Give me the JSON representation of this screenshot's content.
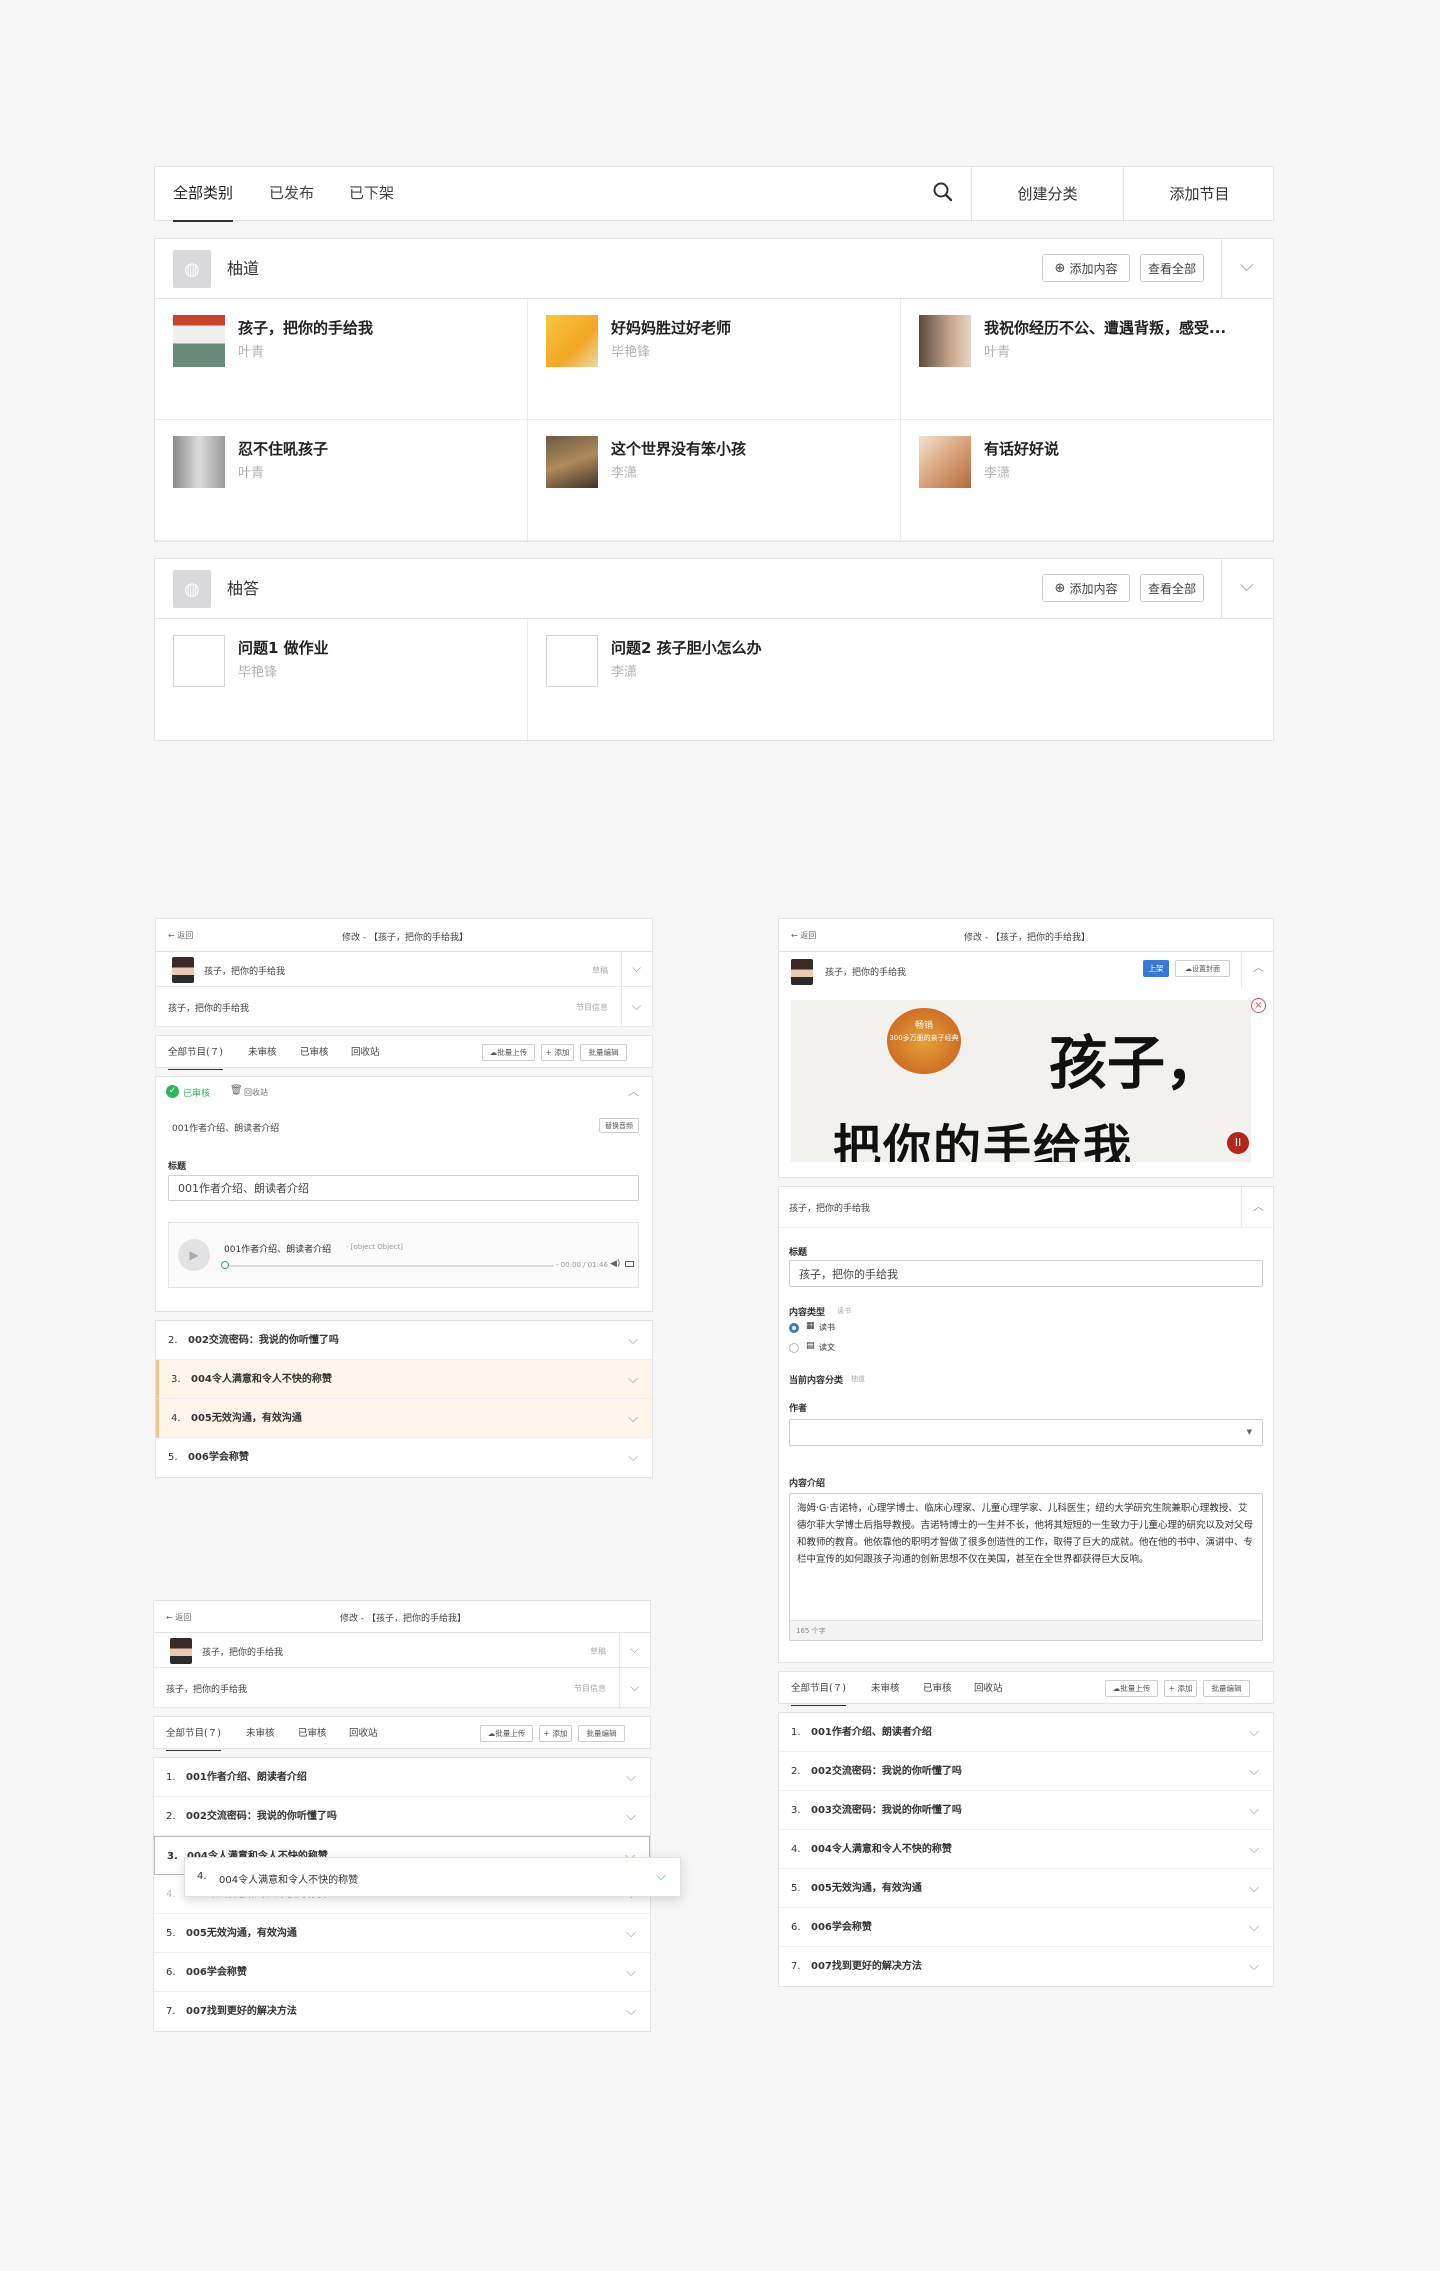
{
  "topbar": {
    "tabs": [
      "全部类别",
      "已发布",
      "已下架"
    ],
    "create_category": "创建分类",
    "add_program": "添加节目"
  },
  "categories": [
    {
      "name": "柚道",
      "add_label": "添加内容",
      "view_all": "查看全部",
      "items": [
        {
          "title": "孩子，把你的手给我",
          "author": "叶青"
        },
        {
          "title": "好妈妈胜过好老师",
          "author": "毕艳锋"
        },
        {
          "title": "我祝你经历不公、遭遇背叛，感受...",
          "author": "叶青"
        },
        {
          "title": "忍不住吼孩子",
          "author": "叶青"
        },
        {
          "title": "这个世界没有笨小孩",
          "author": "李潇"
        },
        {
          "title": "有话好好说",
          "author": "李潇"
        }
      ]
    },
    {
      "name": "柚答",
      "add_label": "添加内容",
      "view_all": "查看全部",
      "items": [
        {
          "title": "问题1 做作业",
          "author": "毕艳锋"
        },
        {
          "title": "问题2 孩子胆小怎么办",
          "author": "李潇"
        }
      ]
    }
  ],
  "panel_common": {
    "back": "返回",
    "title": "修改 - 【孩子，把你的手给我】",
    "book_title": "孩子，把你的手给我",
    "draft": "草稿",
    "program_info": "节目信息",
    "tabs": [
      "全部节目(７)",
      "未审核",
      "已审核",
      "回收站"
    ],
    "bulk_upload": "批量上传",
    "add": "+ 添加",
    "bulk_edit": "批量编辑"
  },
  "panel_a": {
    "status_reviewed": "已审核",
    "status_recycle": "回收站",
    "item_name": "001作者介绍、朗读者介绍",
    "replace_audio": "替换音频",
    "title_label": "标题",
    "title_value": "001作者介绍、朗读者介绍",
    "audio_name": "001作者介绍、朗读者介绍",
    "audio_sub": "- [object Object]",
    "audio_time": "- 00:00 / 01:46",
    "list": [
      {
        "n": "2.",
        "t": "002交流密码：我说的你听懂了吗"
      },
      {
        "n": "3.",
        "t": "004令人满意和令人不快的称赞"
      },
      {
        "n": "4.",
        "t": "005无效沟通，有效沟通"
      },
      {
        "n": "5.",
        "t": "006学会称赞"
      }
    ]
  },
  "panel_b": {
    "list": [
      {
        "n": "1.",
        "t": "001作者介绍、朗读者介绍"
      },
      {
        "n": "2.",
        "t": "002交流密码：我说的你听懂了吗"
      },
      {
        "n": "3.",
        "t": "004令人满意和令人不快的称赞"
      },
      {
        "n": "4.",
        "t": "004令人满意和令人不快的称赞"
      },
      {
        "n": "5.",
        "t": "005无效沟通，有效沟通"
      },
      {
        "n": "6.",
        "t": "006学会称赞"
      },
      {
        "n": "7.",
        "t": "007找到更好的解决方法"
      }
    ],
    "drag_item": {
      "n": "4.",
      "t": "004令人满意和令人不快的称赞"
    }
  },
  "panel_c": {
    "publish": "上架",
    "set_cover": "设置封面",
    "cover_badge_1": "畅销",
    "cover_badge_2": "300多万册的亲子经典",
    "cover_title_1": "孩子，",
    "cover_title_2": "把你的手给我",
    "cover_badge_ii": "II",
    "section_title": "孩子，把你的手给我",
    "title_label": "标题",
    "title_value": "孩子，把你的手给我",
    "content_type_label": "内容类型",
    "content_type_hint": "读书",
    "opt1": "读书",
    "opt2": "读文",
    "current_category_label": "当前内容分类",
    "current_category_value": "柚道",
    "author_label": "作者",
    "intro_label": "内容介绍",
    "intro_text": "海姆·G·吉诺特，心理学博士、临床心理家、儿童心理学家、儿科医生；纽约大学研究生院兼职心理教授、艾德尔菲大学博士后指导教授。吉诺特博士的一生并不长，他将其短短的一生致力于儿童心理的研究以及对父母和教师的教育。他依靠他的职明才智做了很多创造性的工作，取得了巨大的成就。他在他的书中、演讲中、专栏中宣传的如何跟孩子沟通的创新思想不仅在美国，甚至在全世界都获得巨大反响。",
    "char_count": "165 个字",
    "list": [
      {
        "n": "1.",
        "t": "001作者介绍、朗读者介绍"
      },
      {
        "n": "2.",
        "t": "002交流密码：我说的你听懂了吗"
      },
      {
        "n": "3.",
        "t": "003交流密码：我说的你听懂了吗"
      },
      {
        "n": "4.",
        "t": "004令人满意和令人不快的称赞"
      },
      {
        "n": "5.",
        "t": "005无效沟通，有效沟通"
      },
      {
        "n": "6.",
        "t": "006学会称赞"
      },
      {
        "n": "7.",
        "t": "007找到更好的解决方法"
      }
    ]
  }
}
